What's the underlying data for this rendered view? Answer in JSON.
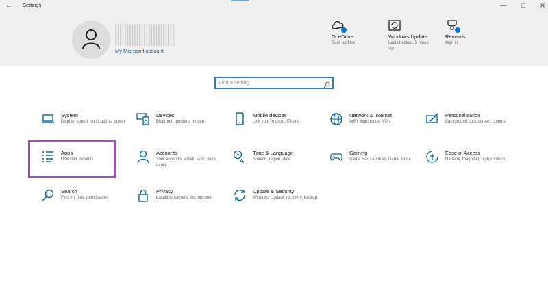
{
  "window": {
    "title": "Settings"
  },
  "account": {
    "link": "My Microsoft account"
  },
  "header_tiles": [
    {
      "title": "OneDrive",
      "subtitle": "Back up files",
      "icon": "cloud-icon"
    },
    {
      "title": "Windows Update",
      "subtitle": "Last checked: 5 hours ago",
      "icon": "refresh-icon"
    },
    {
      "title": "Rewards",
      "subtitle": "Sign in",
      "icon": "trophy-icon"
    }
  ],
  "search": {
    "placeholder": "Find a setting"
  },
  "tiles": [
    {
      "title": "System",
      "desc": "Display, sound, notifications, power",
      "icon": "laptop-icon"
    },
    {
      "title": "Devices",
      "desc": "Bluetooth, printers, mouse",
      "icon": "keyboard-speaker-icon"
    },
    {
      "title": "Mobile devices",
      "desc": "Link your Android, iPhone",
      "icon": "phone-icon"
    },
    {
      "title": "Network & Internet",
      "desc": "WiFi, flight mode, VPN",
      "icon": "globe-icon"
    },
    {
      "title": "Personalisation",
      "desc": "Background, lock screen, colours",
      "icon": "pen-screen-icon"
    },
    {
      "title": "Apps",
      "desc": "Uninstall, defaults",
      "icon": "apps-list-icon"
    },
    {
      "title": "Accounts",
      "desc": "Your accounts, email, sync, work, family",
      "icon": "person-icon"
    },
    {
      "title": "Time & Language",
      "desc": "Speech, region, date",
      "icon": "time-language-icon"
    },
    {
      "title": "Gaming",
      "desc": "Game Bar, captures, Game Mode",
      "icon": "gamepad-icon"
    },
    {
      "title": "Ease of Access",
      "desc": "Narrator, magnifier, high contrast",
      "icon": "ease-of-access-icon"
    },
    {
      "title": "Search",
      "desc": "Find my files, permissions",
      "icon": "search-icon"
    },
    {
      "title": "Privacy",
      "desc": "Location, camera, microphone",
      "icon": "lock-icon"
    },
    {
      "title": "Update & Security",
      "desc": "Windows Update, recovery, backup",
      "icon": "sync-icon"
    }
  ],
  "colors": {
    "accent": "#0078d7",
    "highlight": "#9b51c4",
    "header_bg": "#f0f0f0"
  }
}
